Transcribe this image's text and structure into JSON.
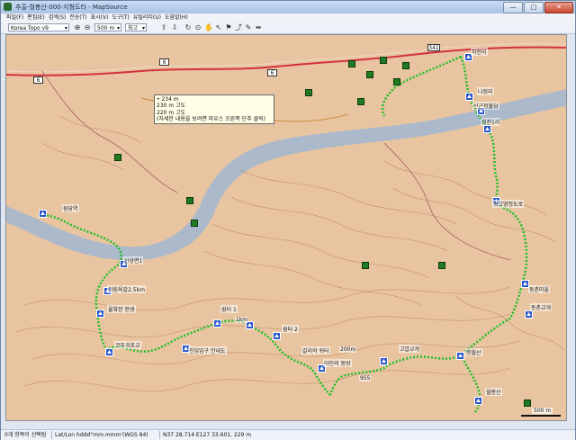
{
  "window": {
    "title": "추출-월봉산-000-지형도타 - MapSource",
    "buttons": [
      "—",
      "□",
      "✕"
    ]
  },
  "menu": [
    "파일(F)",
    "편집(E)",
    "검색(S)",
    "전송(T)",
    "표시(V)",
    "도구(T)",
    "유틸리티(U)",
    "도움말(H)"
  ],
  "toolbar": {
    "map_product": "Korea Topo v9",
    "zoom_level": "500 m",
    "detail": "최고"
  },
  "map": {
    "tooltip_lines": [
      "• 234 m",
      "230 m 고도",
      "220 m 고도",
      "(자세한 내용을 보려면 마우스 오른쪽 단추 클릭)"
    ],
    "route_badges": [
      "6",
      "6",
      "6",
      "341"
    ],
    "labels": {
      "start_top": "하천리",
      "residence": "나정리",
      "nearby": "신근정불당",
      "ridge1": "최천1리",
      "trail1": "최고영정도로",
      "east_ridge": "동촌마을",
      "east_pass": "동촌교개",
      "west_start": "원당역",
      "west_station": "신상면1",
      "sign1": "가림육갈2.5km",
      "sign2": "율화된 현생",
      "sign3": "코뚜귀초교",
      "sign4": "진입입구 안내도",
      "peak1": "쉼터 1",
      "peak2": "쉼터 2",
      "climb": "갈리의 쉬터",
      "dist200": "200m",
      "mid": "아인의 동방",
      "pass": "고압교개",
      "south": "청월산",
      "end": "월봉산",
      "elev955": "955",
      "elev1": "1km"
    },
    "scale_text": "500 m"
  },
  "status": {
    "count": "0개 항목이 선택됨",
    "format": "Lat/Lon hddd°mm.mmm'(WGS 84)",
    "coords": "N37 28.714 E127 33.601, 229 m"
  }
}
